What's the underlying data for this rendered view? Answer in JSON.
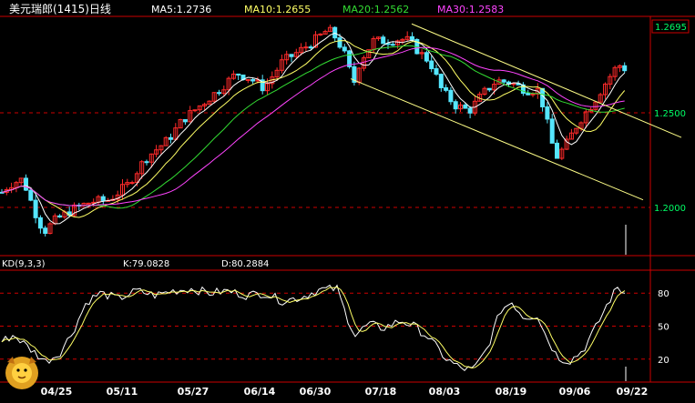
{
  "header": {
    "title": "美元瑞郎(1415)日线",
    "ma5": "MA5:1.2736",
    "ma10": "MA10:1.2655",
    "ma20": "MA20:1.2562",
    "ma30": "MA30:1.2583",
    "current_price": "1.2695"
  },
  "kd_header": {
    "label": "KD(9,3,3)",
    "k": "K:79.0828",
    "d": "D:80.2884"
  },
  "colors": {
    "background": "#000000",
    "up": "#ff2a2a",
    "down": "#55e6ff",
    "ma5": "#ffffff",
    "ma10": "#ffff66",
    "ma20": "#33dd33",
    "ma30": "#ff44ff",
    "k_line": "#ffffff",
    "d_line": "#ffff66",
    "channel": "#ffff88",
    "grid": "#cc0000",
    "title": "#ffffff"
  },
  "chart_data": [
    {
      "type": "candlestick",
      "title": "美元瑞郎(1415)日线",
      "yticks": [
        "1.2000",
        "1.2500"
      ],
      "ytick_values": [
        1.2,
        1.25
      ],
      "ylim": [
        1.175,
        1.3
      ],
      "x_tick_labels": [
        "04/25",
        "05/11",
        "05/27",
        "06/14",
        "06/30",
        "07/18",
        "08/03",
        "08/19",
        "09/06",
        "09/22"
      ],
      "last_close": 1.2695,
      "series": [
        {
          "name": "MA5",
          "value": 1.2736
        },
        {
          "name": "MA10",
          "value": 1.2655
        },
        {
          "name": "MA20",
          "value": 1.2562
        },
        {
          "name": "MA30",
          "value": 1.2583
        }
      ],
      "grid": true
    },
    {
      "type": "line",
      "title": "KD(9,3,3)",
      "yticks": [
        "20",
        "50",
        "80"
      ],
      "ytick_values": [
        20,
        50,
        80
      ],
      "ylim": [
        0,
        100
      ],
      "series": [
        {
          "name": "K",
          "last": 79.0828
        },
        {
          "name": "D",
          "last": 80.2884
        }
      ],
      "grid": true
    }
  ]
}
